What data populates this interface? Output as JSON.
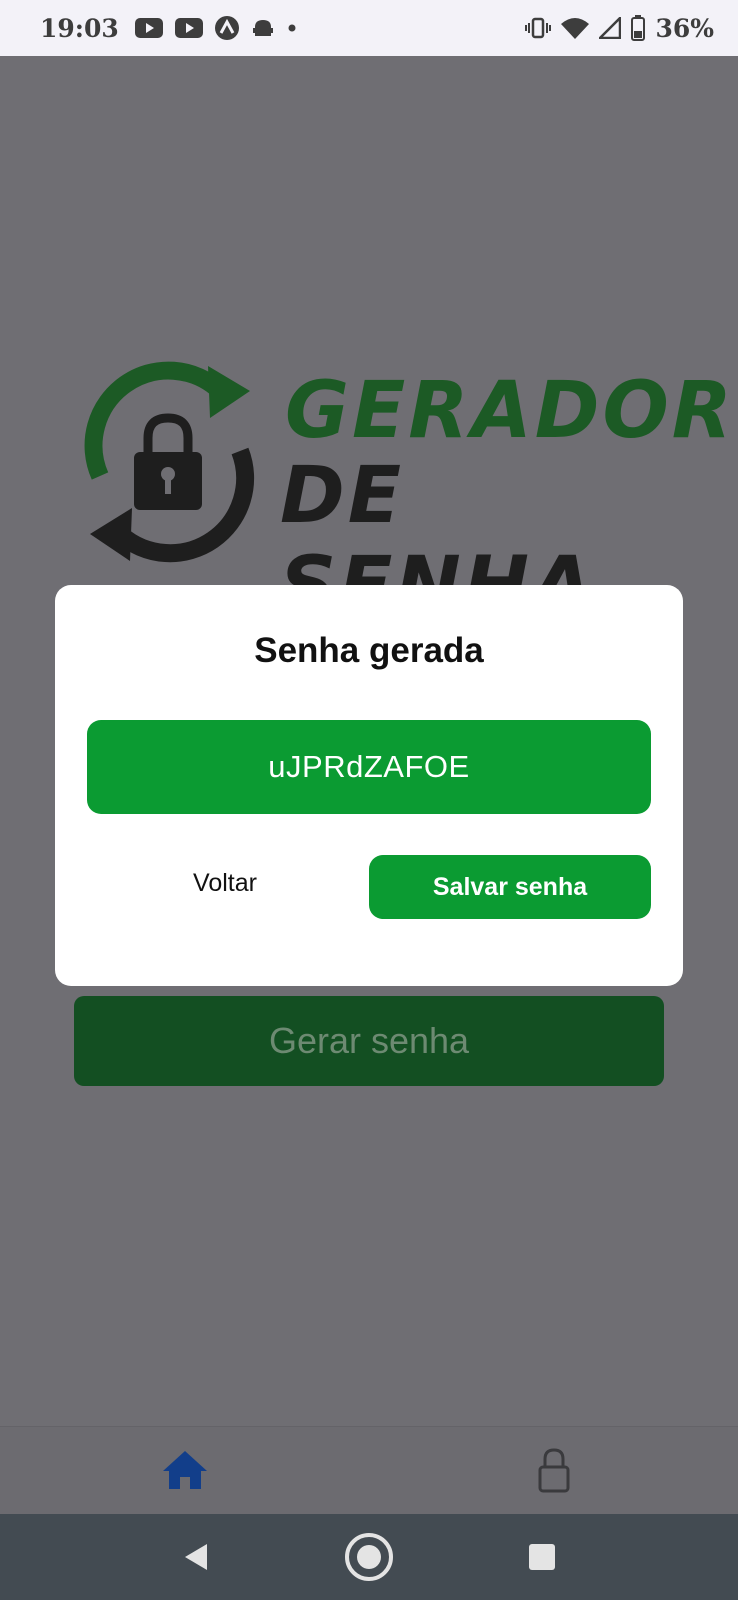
{
  "status_bar": {
    "time": "19:03",
    "battery": "36%",
    "left_icons": [
      "youtube-icon",
      "youtube-icon",
      "app-icon",
      "android-icon",
      "dot-icon"
    ],
    "right_icons": [
      "vibrate-icon",
      "wifi-icon",
      "signal-icon",
      "battery-icon"
    ]
  },
  "logo": {
    "line1": "GERADOR",
    "line2": "DE SENHA",
    "colors": {
      "green": "#1c5a25",
      "dark": "#1e1e1e"
    }
  },
  "main": {
    "generate_label": "Gerar senha"
  },
  "modal": {
    "title": "Senha gerada",
    "password": "uJPRdZAFOE",
    "back_label": "Voltar",
    "save_label": "Salvar senha",
    "accent": "#0b9b32"
  },
  "tab_bar": {
    "tabs": [
      {
        "icon": "home-icon",
        "active": true
      },
      {
        "icon": "lock-icon",
        "active": false
      }
    ],
    "active_color": "#123e8a"
  },
  "nav_bar": {
    "buttons": [
      "back-triangle-icon",
      "home-circle-icon",
      "recents-square-icon"
    ]
  }
}
